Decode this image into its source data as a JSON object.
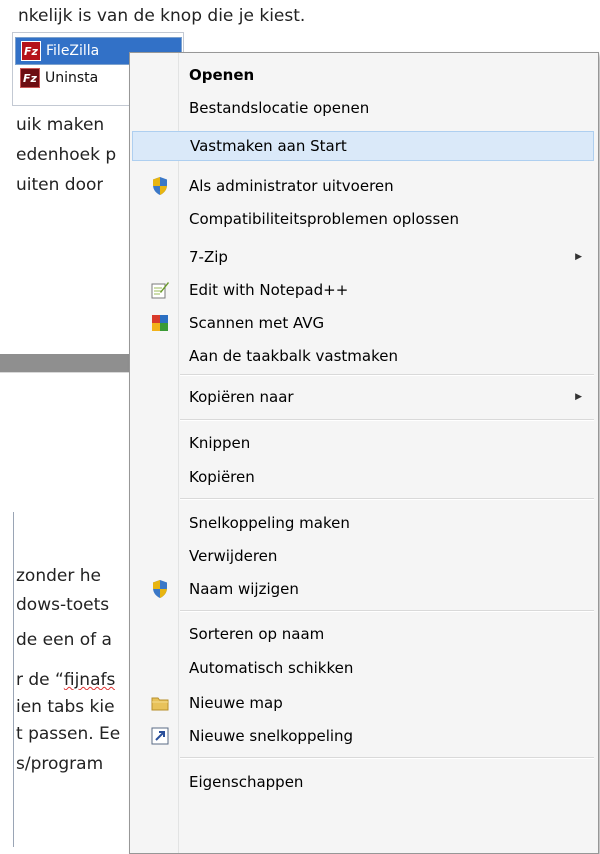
{
  "background_doc": {
    "top_line": "nkelijk is van de knop die je kiest.",
    "fragments": [
      "uik maken",
      "edenhoek p",
      "uiten door",
      "zonder he",
      "dows-toets",
      "de een of a",
      "r de “",
      "fijnafs",
      "ien tabs kie",
      "t passen. Ee",
      "s/program"
    ]
  },
  "start_list": {
    "items": [
      {
        "label": "FileZilla",
        "icon": "filezilla-icon",
        "selected": true
      },
      {
        "label": "Uninsta",
        "icon": "filezilla-uninstall-icon",
        "selected": false
      }
    ]
  },
  "context_menu": {
    "items": [
      {
        "label": "Openen",
        "bold": true
      },
      {
        "label": "Bestandslocatie openen"
      },
      {
        "label": "Vastmaken aan Start",
        "highlighted": true
      },
      {
        "label": "Als administrator uitvoeren",
        "icon": "uac-shield-icon"
      },
      {
        "label": "Compatibiliteitsproblemen oplossen"
      },
      {
        "label": "7-Zip",
        "submenu": true
      },
      {
        "label": "Edit with Notepad++",
        "icon": "notepad-plus-plus-icon"
      },
      {
        "label": "Scannen met AVG",
        "icon": "avg-icon"
      },
      {
        "label": "Aan de taakbalk vastmaken"
      },
      {
        "label": "Kopiëren naar",
        "submenu": true
      },
      {
        "label": "Knippen"
      },
      {
        "label": "Kopiëren"
      },
      {
        "label": "Snelkoppeling maken"
      },
      {
        "label": "Verwijderen"
      },
      {
        "label": "Naam wijzigen",
        "icon": "uac-shield-icon"
      },
      {
        "label": "Sorteren op naam"
      },
      {
        "label": "Automatisch schikken"
      },
      {
        "label": "Nieuwe map",
        "icon": "folder-icon"
      },
      {
        "label": "Nieuwe snelkoppeling",
        "icon": "shortcut-icon"
      },
      {
        "label": "Eigenschappen"
      }
    ],
    "submenu_arrow": "▶",
    "highlight_color": "#dae9f9"
  }
}
